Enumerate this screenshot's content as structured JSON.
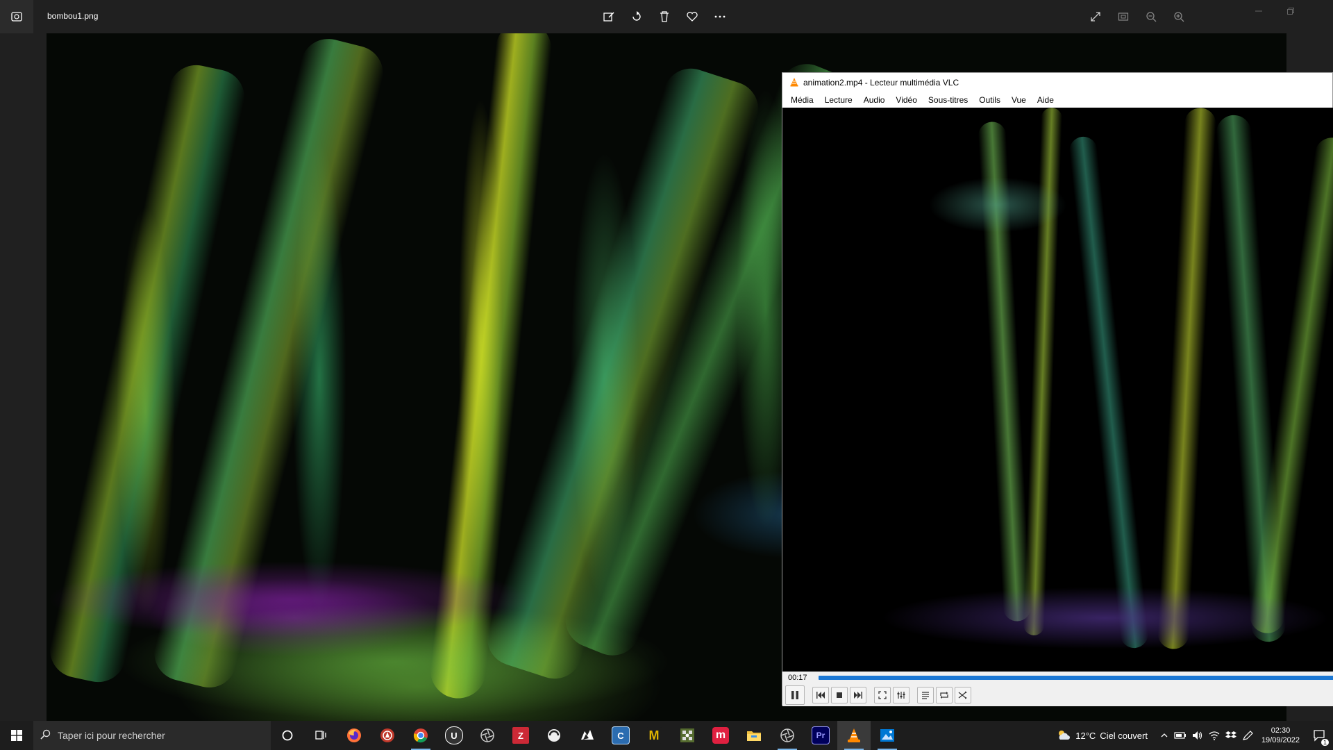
{
  "photos": {
    "filename": "bombou1.png",
    "toolbar": [
      "edit-icon",
      "rotate-icon",
      "delete-icon",
      "favorite-icon",
      "more-icon"
    ],
    "right_toolbar": [
      "expand-icon",
      "slideshow-icon",
      "zoom-out-icon",
      "zoom-in-icon"
    ]
  },
  "vlc": {
    "title": "animation2.mp4 - Lecteur multimédia VLC",
    "menu": [
      "Média",
      "Lecture",
      "Audio",
      "Vidéo",
      "Sous-titres",
      "Outils",
      "Vue",
      "Aide"
    ],
    "time": "00:17",
    "progress": 0.02
  },
  "taskbar": {
    "search_placeholder": "Taper ici pour rechercher",
    "weather_temp": "12°C",
    "weather_desc": "Ciel couvert",
    "time": "02:30",
    "date": "19/09/2022",
    "notification_count": "1",
    "apps": [
      {
        "name": "cortana",
        "label": "",
        "color": "#1d1d1d"
      },
      {
        "name": "task-view",
        "label": "",
        "color": "#1d1d1d"
      },
      {
        "name": "firefox",
        "label": "",
        "color": "#ff7139"
      },
      {
        "name": "app-red-circle",
        "label": "",
        "color": "#c0392b"
      },
      {
        "name": "chrome",
        "label": "",
        "color": "#34a853"
      },
      {
        "name": "unreal",
        "label": "U",
        "color": "#333333"
      },
      {
        "name": "aperture",
        "label": "",
        "color": "#444444"
      },
      {
        "name": "zotero",
        "label": "Z",
        "color": "#cc2936"
      },
      {
        "name": "app-swirl",
        "label": "",
        "color": "#555555"
      },
      {
        "name": "rhino",
        "label": "",
        "color": "#222222"
      },
      {
        "name": "cloudcompare",
        "label": "C",
        "color": "#2b6cb0"
      },
      {
        "name": "meshroom",
        "label": "M",
        "color": "#e0b400"
      },
      {
        "name": "app-grid",
        "label": "",
        "color": "#556b2f"
      },
      {
        "name": "app-m-red",
        "label": "m",
        "color": "#e02040"
      },
      {
        "name": "file-explorer",
        "label": "",
        "color": "#f0c040"
      },
      {
        "name": "blender-like",
        "label": "",
        "color": "#555555"
      },
      {
        "name": "premiere",
        "label": "Pr",
        "color": "#00005b"
      },
      {
        "name": "vlc",
        "label": "",
        "color": "#ff8800"
      },
      {
        "name": "photos",
        "label": "",
        "color": "#0078d4"
      }
    ]
  }
}
